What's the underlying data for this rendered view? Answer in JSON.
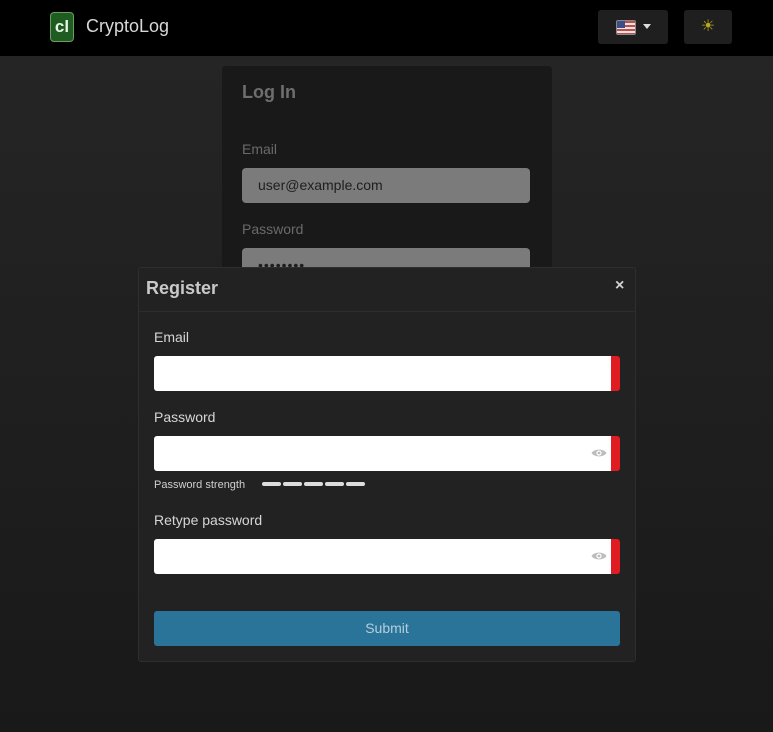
{
  "navbar": {
    "logo_text": "cl",
    "brand": "CryptoLog",
    "language_icon": "us-flag-icon",
    "theme_icon": "sun-icon",
    "theme_glyph": "☀"
  },
  "login": {
    "title": "Log In",
    "email_label": "Email",
    "email_value": "user@example.com",
    "password_label": "Password",
    "password_value": "••••••••"
  },
  "register": {
    "title": "Register",
    "close_glyph": "×",
    "email_label": "Email",
    "email_value": "",
    "password_label": "Password",
    "password_value": "",
    "strength_label": "Password strength",
    "strength_segments": 5,
    "retype_label": "Retype password",
    "retype_value": "",
    "submit_label": "Submit",
    "accent_color": "#2a7499",
    "invalid_color": "#e11b22"
  }
}
